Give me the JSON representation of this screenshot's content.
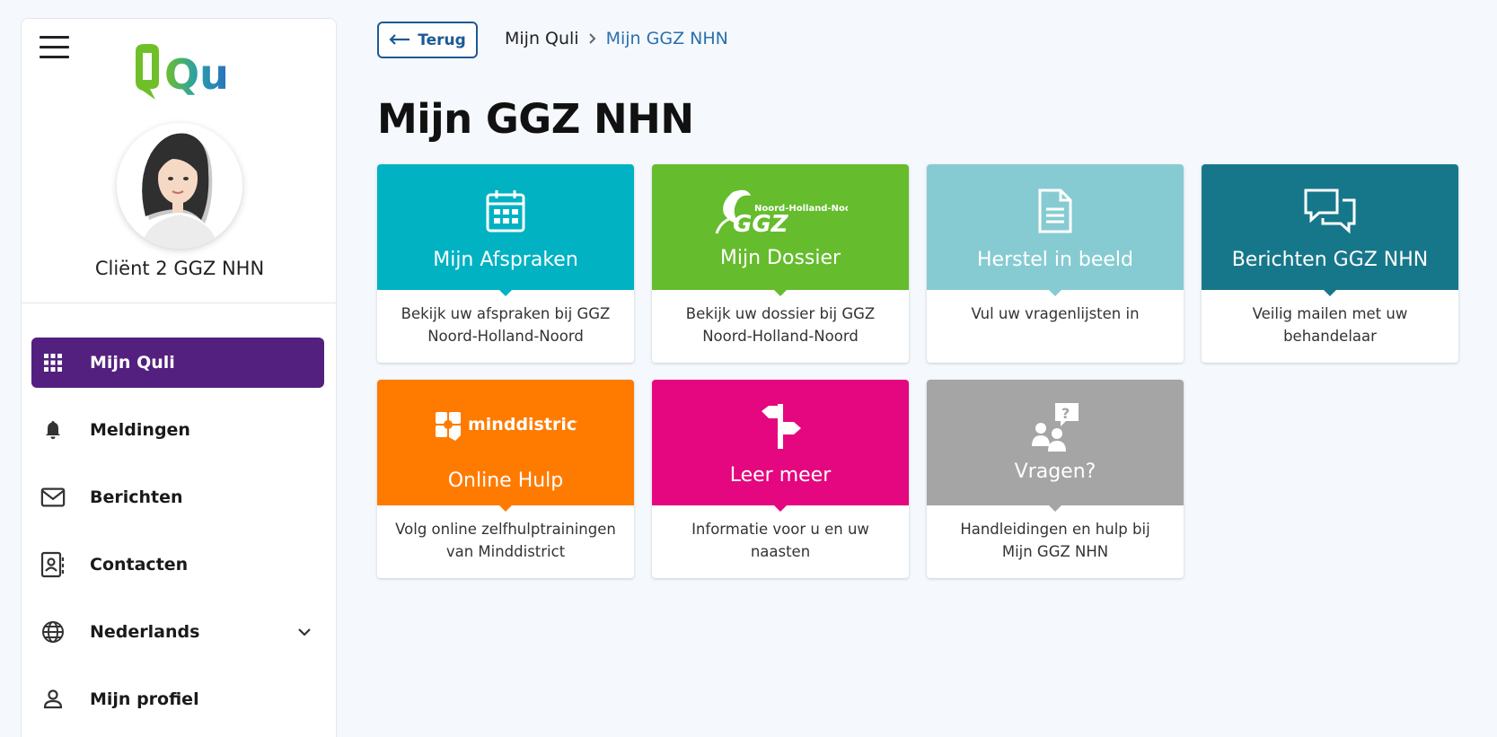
{
  "sidebar": {
    "logo_text": "Quli",
    "user_name": "Cliënt 2 GGZ NHN",
    "nav": [
      {
        "label": "Mijn Quli",
        "icon": "grid-icon",
        "active": true
      },
      {
        "label": "Meldingen",
        "icon": "bell-icon"
      },
      {
        "label": "Berichten",
        "icon": "envelope-icon"
      },
      {
        "label": "Contacten",
        "icon": "contacts-icon"
      },
      {
        "label": "Nederlands",
        "icon": "globe-icon"
      },
      {
        "label": "Mijn profiel",
        "icon": "user-icon"
      }
    ]
  },
  "header": {
    "back_label": "Terug",
    "breadcrumb": [
      "Mijn Quli",
      "Mijn GGZ NHN"
    ],
    "page_title": "Mijn GGZ NHN"
  },
  "cards": [
    {
      "title": "Mijn Afspraken",
      "description": "Bekijk uw afspraken bij GGZ Noord-Holland-Noord",
      "color": "#00b2c2",
      "icon": "calendar-icon"
    },
    {
      "title": "Mijn Dossier",
      "description": "Bekijk uw dossier bij GGZ Noord-Holland-Noord",
      "color": "#65bc2d",
      "icon": "ggz-logo",
      "logo_text": "GGZ",
      "logo_subtext": "Noord-Holland-Noord"
    },
    {
      "title": "Herstel in beeld",
      "description": "Vul uw vragenlijsten in",
      "color": "#87cbd2",
      "icon": "document-icon"
    },
    {
      "title": "Berichten GGZ NHN",
      "description": "Veilig mailen met uw behandelaar",
      "color": "#17778a",
      "icon": "chat-bubbles-icon"
    },
    {
      "title": "Online Hulp",
      "description": "Volg online zelfhulptrainingen van Minddistrict",
      "color": "#ff7b00",
      "icon": "minddistrict-logo",
      "logo_text": "minddistrict"
    },
    {
      "title": "Leer meer",
      "description": "Informatie voor u en uw naasten",
      "color": "#e5077f",
      "icon": "signpost-icon"
    },
    {
      "title": "Vragen?",
      "description": "Handleidingen en hulp bij Mijn GGZ NHN",
      "color": "#a5a5a5",
      "icon": "question-people-icon"
    }
  ]
}
